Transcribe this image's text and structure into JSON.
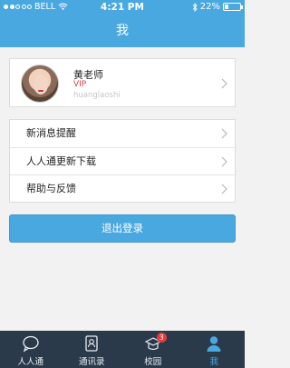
{
  "status_bar": {
    "carrier": "BELL",
    "time": "4:21 PM",
    "battery": "22%",
    "battery_level": 0.22,
    "signal_dots_filled": 2,
    "signal_dots_total": 5
  },
  "nav": {
    "title": "我"
  },
  "profile": {
    "name": "黄老师",
    "badge": "VIP",
    "username": "huanglaoshi",
    "avatar_icon": "avatar"
  },
  "menu": {
    "items": [
      {
        "label": "新消息提醒"
      },
      {
        "label": "人人通更新下载"
      },
      {
        "label": "帮助与反馈"
      }
    ]
  },
  "logout": {
    "label": "退出登录"
  },
  "tabbar": {
    "tabs": [
      {
        "label": "人人通",
        "icon": "chat-bubble-icon",
        "active": false
      },
      {
        "label": "通讯录",
        "icon": "contacts-book-icon",
        "active": false
      },
      {
        "label": "校园",
        "icon": "graduation-cap-icon",
        "active": false,
        "badge": "3"
      },
      {
        "label": "我",
        "icon": "person-icon",
        "active": true
      }
    ]
  },
  "colors": {
    "accent": "#4aa8e0",
    "tabbar": "#2b3a4b",
    "vip": "#e23b3b",
    "badge": "#e83a3a"
  }
}
